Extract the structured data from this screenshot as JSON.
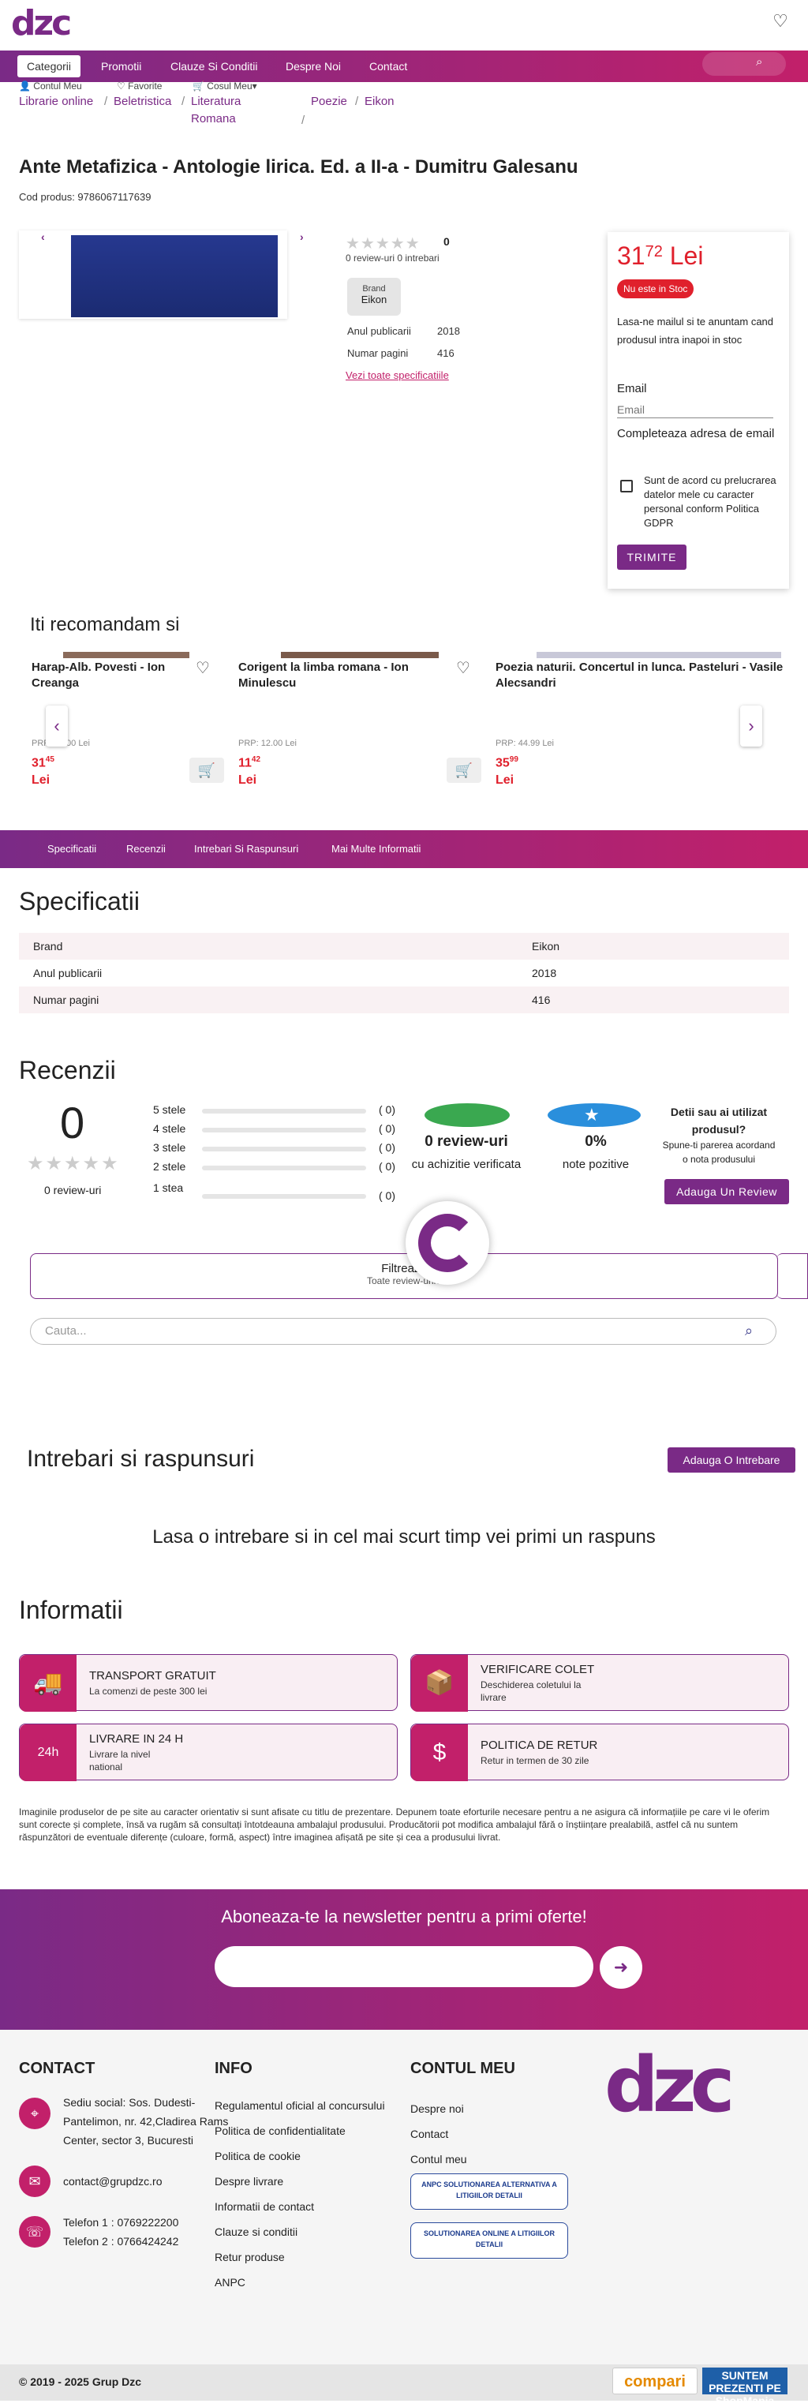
{
  "header": {
    "logo": "dzc",
    "nav": [
      "Categorii",
      "Promotii",
      "Clauze Si Conditii",
      "Despre Noi",
      "Contact"
    ],
    "subnav": [
      "Contul Meu",
      "Favorite",
      "Cosul Meu"
    ]
  },
  "breadcrumb": [
    "Librarie online",
    "Beletristica",
    "Literatura Romana",
    "Poezie",
    "Eikon"
  ],
  "product": {
    "title": "Ante Metafizica - Antologie lirica. Ed. a II-a - Dumitru Galesanu",
    "code_label": "Cod produs: 9786067117639",
    "rating_count": "0",
    "reviews_line": "0 review-uri 0 intrebari",
    "brand_label": "Brand",
    "brand_value": "Eikon",
    "specs": [
      {
        "k": "Anul publicarii",
        "v": "2018"
      },
      {
        "k": "Numar pagini",
        "v": "416"
      }
    ],
    "see_all": "Vezi toate specificatiile"
  },
  "pricebox": {
    "price_int": "31",
    "price_dec": "72",
    "currency": "Lei",
    "stock": "Nu este in Stoc",
    "notify": "Lasa-ne mailul si te anuntam cand produsul intra inapoi in stoc",
    "email_label": "Email",
    "email_placeholder": "Email",
    "email_hint": "Completeaza adresa de email",
    "gdpr": "Sunt de acord cu prelucrarea datelor mele cu caracter personal conform Politica GDPR",
    "submit": "TRIMITE"
  },
  "recommend": {
    "title": "Iti recomandam si",
    "items": [
      {
        "title": "Harap-Alb. Povesti - Ion Creanga",
        "prp": "PRP: 40.00 Lei",
        "price_int": "31",
        "price_dec": "45",
        "cur": "Lei"
      },
      {
        "title": "Corigent la limba romana - Ion Minulescu",
        "prp": "PRP: 12.00 Lei",
        "price_int": "11",
        "price_dec": "42",
        "cur": "Lei"
      },
      {
        "title": "Poezia naturii. Concertul in lunca. Pasteluri - Vasile Alecsandri",
        "prp": "PRP: 44.99 Lei",
        "price_int": "35",
        "price_dec": "99",
        "cur": "Lei"
      }
    ]
  },
  "tabs": [
    "Specificatii",
    "Recenzii",
    "Intrebari Si Raspunsuri",
    "Mai Multe Informatii"
  ],
  "specs_section": {
    "title": "Specificatii",
    "rows": [
      {
        "k": "Brand",
        "v": "Eikon"
      },
      {
        "k": "Anul publicarii",
        "v": "2018"
      },
      {
        "k": "Numar pagini",
        "v": "416"
      }
    ]
  },
  "reviews": {
    "title": "Recenzii",
    "score": "0",
    "count": "0 review-uri",
    "bars": [
      {
        "l": "5 stele",
        "c": "( 0)"
      },
      {
        "l": "4 stele",
        "c": "( 0)"
      },
      {
        "l": "3 stele",
        "c": "( 0)"
      },
      {
        "l": "2 stele",
        "c": "( 0)"
      },
      {
        "l": "1 stea",
        "c": "( 0)"
      }
    ],
    "verified_count": "0 review-uri",
    "verified_sub": "cu achizitie verificata",
    "positive": "0%",
    "positive_sub": "note pozitive",
    "used_q": "Detii sau ai utilizat produsul?",
    "used_sub": "Spune-ti parerea acordand o nota produsului",
    "add": "Adauga Un Review",
    "filter": "Filtreaza",
    "filter_sub": "Toate review-urile",
    "search_placeholder": "Cauta..."
  },
  "qa": {
    "title": "Intrebari si raspunsuri",
    "add": "Adauga O Intrebare",
    "empty": "Lasa o intrebare si in cel mai scurt timp vei primi un raspuns"
  },
  "info": {
    "title": "Informatii",
    "items": [
      {
        "t": "TRANSPORT GRATUIT",
        "s": "La comenzi de peste 300 lei",
        "icon": "truck-icon"
      },
      {
        "t": "VERIFICARE COLET",
        "s": "Deschiderea coletului la livrare",
        "icon": "package-icon"
      },
      {
        "t": "LIVRARE IN 24 H",
        "s": "Livrare la nivel national",
        "icon": "clock-24h-icon"
      },
      {
        "t": "POLITICA DE RETUR",
        "s": "Retur in termen de 30 zile",
        "icon": "money-return-icon"
      }
    ],
    "disclaimer": "Imaginile produselor de pe site au caracter orientativ si sunt afisate cu titlu de prezentare. Depunem toate eforturile necesare pentru a ne asigura că informațiile pe care vi le oferim sunt corecte și complete, însă va rugăm să consultați întotdeauna ambalajul produsului. Producătorii pot modifica ambalajul fără o înștiințare prealabilă, astfel că nu suntem răspunzători de eventuale diferențe (culoare, formă, aspect) între imaginea afișată pe site și cea a produsului livrat."
  },
  "newsletter": {
    "title": "Aboneaza-te la newsletter pentru a primi oferte!"
  },
  "footer": {
    "contact_title": "CONTACT",
    "address": "Sediu social: Sos. Dudesti-Pantelimon, nr. 42,Cladirea Rams Center, sector 3, Bucuresti",
    "email": "contact@grupdzc.ro",
    "phone1": "Telefon 1 : 0769222200",
    "phone2": "Telefon 2 : 0766424242",
    "info_title": "INFO",
    "info_links": [
      "Regulamentul oficial al concursului",
      "Politica de confidentialitate",
      "Politica de cookie",
      "Despre livrare",
      "Informatii de contact",
      "Clauze si conditii",
      "Retur produse",
      "ANPC"
    ],
    "account_title": "CONTUL MEU",
    "account_links": [
      "Despre noi",
      "Contact",
      "Contul meu"
    ],
    "anpc1": "ANPC SOLUTIONAREA ALTERNATIVA A LITIGIILOR DETALII",
    "anpc2": "SOLUTIONAREA ONLINE A LITIGIILOR DETALII",
    "copyright": "© 2019 - 2025 Grup Dzc",
    "compari": "compari",
    "shopmania": "SUNTEM PREZENTI PE ShopMania"
  },
  "colors": {
    "brand": "#7a2a86",
    "accent": "#c2206a",
    "price": "#e0202c"
  }
}
